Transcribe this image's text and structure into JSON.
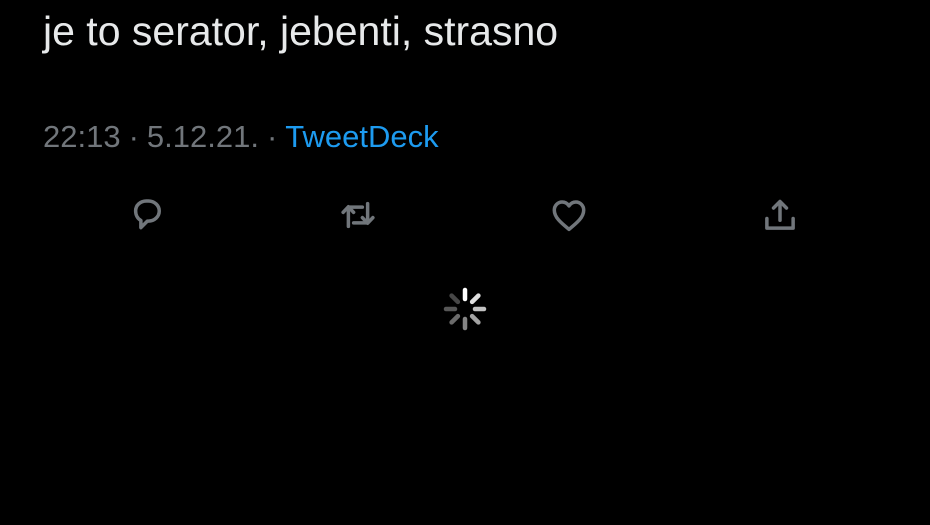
{
  "tweet": {
    "text": "je to serator, jebenti, strasno",
    "time": "22:13",
    "date": "5.12.21.",
    "separator": "·",
    "source": "TweetDeck"
  },
  "actions": [
    {
      "name": "reply",
      "icon": "reply-icon"
    },
    {
      "name": "retweet",
      "icon": "retweet-icon"
    },
    {
      "name": "like",
      "icon": "heart-icon"
    },
    {
      "name": "share",
      "icon": "share-icon"
    }
  ],
  "loading": {
    "icon": "loading-spinner-icon"
  },
  "colors": {
    "background": "#000000",
    "text": "#e7e9ea",
    "secondary": "#71767b",
    "link": "#1d9bf0"
  }
}
